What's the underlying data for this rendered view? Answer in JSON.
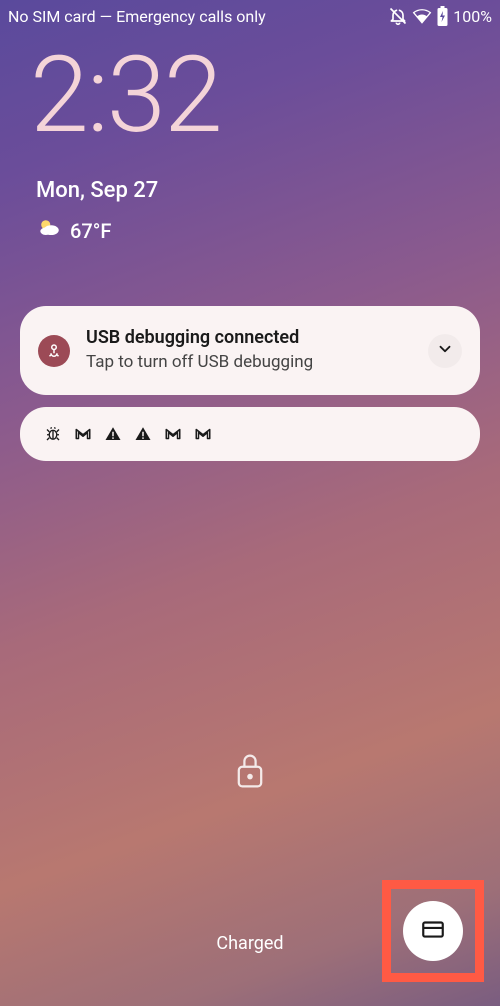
{
  "status": {
    "network_text": "No SIM card — Emergency calls only",
    "battery_pct": "100%"
  },
  "clock": {
    "time": "2:32",
    "date": "Mon, Sep 27",
    "temp": "67°F"
  },
  "notification": {
    "title": "USB debugging connected",
    "subtitle": "Tap to turn off USB debugging"
  },
  "bottom": {
    "charge_status": "Charged"
  }
}
